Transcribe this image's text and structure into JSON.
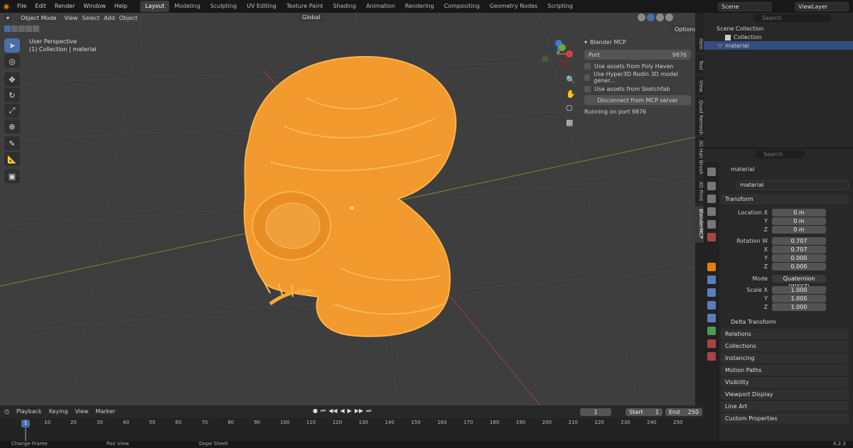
{
  "topbar": {
    "menus": [
      "File",
      "Edit",
      "Render",
      "Window",
      "Help"
    ],
    "workspaces": [
      "Layout",
      "Modeling",
      "Sculpting",
      "UV Editing",
      "Texture Paint",
      "Shading",
      "Animation",
      "Rendering",
      "Compositing",
      "Geometry Nodes",
      "Scripting"
    ],
    "active_workspace": "Layout",
    "scene": "Scene",
    "view_layer": "ViewLayer"
  },
  "viewport": {
    "mode": "Object Mode",
    "menus": [
      "View",
      "Select",
      "Add",
      "Object"
    ],
    "transform_orientation": "Global",
    "options_label": "Options",
    "overlay_title": "User Perspective",
    "overlay_sub": "(1) Collection | material"
  },
  "mcp_panel": {
    "title": "Blender MCP",
    "port_label": "Port",
    "port_value": "9876",
    "options": [
      "Use assets from Poly Haven",
      "Use Hyper3D Rodin 3D model gener...",
      "Use assets from Sketchfab"
    ],
    "disconnect_label": "Disconnect from MCP server",
    "status": "Running on port 9876"
  },
  "side_tabs": [
    "Item",
    "Tool",
    "View",
    "Quad Remesh",
    "3D Hair Brush",
    "3D Print",
    "BlenderMCP"
  ],
  "outliner": {
    "search_placeholder": "Search",
    "root": "Scene Collection",
    "collection": "Collection",
    "object": "material"
  },
  "properties": {
    "search_placeholder": "Search",
    "object_name": "material",
    "object_field": "material",
    "transform_title": "Transform",
    "location": {
      "label": "Location X",
      "x": "0 m",
      "y": "0 m",
      "z": "0 m"
    },
    "rotation": {
      "label": "Rotation W",
      "w": "0.707",
      "x": "0.707",
      "y": "0.000",
      "z": "0.000"
    },
    "mode_label": "Mode",
    "mode_value": "Quaternion (WXYZ)",
    "scale": {
      "label": "Scale X",
      "x": "1.000",
      "y": "1.000",
      "z": "1.000"
    },
    "axis": {
      "y": "Y",
      "z": "Z",
      "x": "X"
    },
    "delta": "Delta Transform",
    "sections": [
      "Relations",
      "Collections",
      "Instancing",
      "Motion Paths",
      "Visibility",
      "Viewport Display",
      "Line Art",
      "Custom Properties"
    ]
  },
  "timeline": {
    "menus": [
      "Playback",
      "Keying",
      "View",
      "Marker"
    ],
    "current_frame": "1",
    "start_label": "Start",
    "start_value": "1",
    "end_label": "End",
    "end_value": "250",
    "ruler": [
      "1",
      "10",
      "20",
      "30",
      "40",
      "50",
      "60",
      "70",
      "80",
      "90",
      "100",
      "110",
      "120",
      "130",
      "140",
      "150",
      "160",
      "170",
      "180",
      "190",
      "200",
      "210",
      "220",
      "230",
      "240",
      "250"
    ]
  },
  "status": {
    "items": [
      "Change Frame",
      "Pan View",
      "Dope Sheet"
    ],
    "version": "4.2.3"
  },
  "colors": {
    "accent": "#4a6ea8",
    "selection": "#ff9d2a",
    "background": "#3e3e3e"
  }
}
